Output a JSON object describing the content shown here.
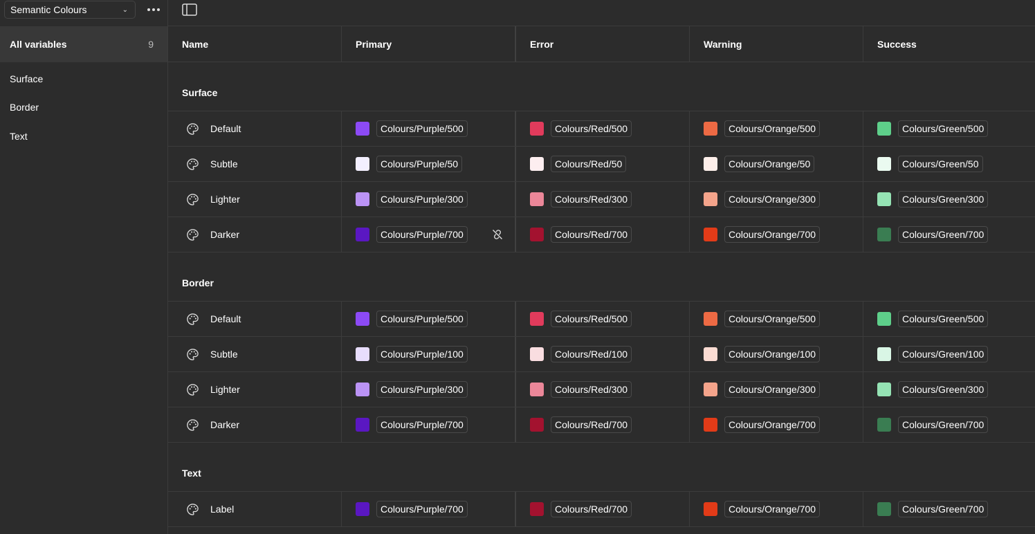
{
  "sidebar": {
    "collection": "Semantic Colours",
    "all_variables_label": "All variables",
    "all_variables_count": "9",
    "groups": [
      "Surface",
      "Border",
      "Text"
    ]
  },
  "columns": [
    "Name",
    "Primary",
    "Error",
    "Warning",
    "Success"
  ],
  "colors": {
    "Colours/Purple/500": "#8c4af5",
    "Colours/Purple/50": "#f3efff",
    "Colours/Purple/100": "#e8ddfd",
    "Colours/Purple/300": "#bb93f5",
    "Colours/Purple/700": "#5a17c2",
    "Colours/Red/500": "#e13b5c",
    "Colours/Red/50": "#fdeef0",
    "Colours/Red/100": "#f9dde0",
    "Colours/Red/300": "#eb8799",
    "Colours/Red/700": "#a3122f",
    "Colours/Orange/500": "#ed6a44",
    "Colours/Orange/50": "#fdefea",
    "Colours/Orange/100": "#fbdcd3",
    "Colours/Orange/300": "#f4a48b",
    "Colours/Orange/700": "#e23b18",
    "Colours/Green/500": "#5ecf8a",
    "Colours/Green/50": "#eafaf0",
    "Colours/Green/100": "#d9f6e5",
    "Colours/Green/300": "#95e3b4",
    "Colours/Green/700": "#3a7d52"
  },
  "groups": [
    {
      "title": "Surface",
      "rows": [
        {
          "name": "Default",
          "values": [
            "Colours/Purple/500",
            "Colours/Red/500",
            "Colours/Orange/500",
            "Colours/Green/500"
          ]
        },
        {
          "name": "Subtle",
          "values": [
            "Colours/Purple/50",
            "Colours/Red/50",
            "Colours/Orange/50",
            "Colours/Green/50"
          ]
        },
        {
          "name": "Lighter",
          "values": [
            "Colours/Purple/300",
            "Colours/Red/300",
            "Colours/Orange/300",
            "Colours/Green/300"
          ]
        },
        {
          "name": "Darker",
          "values": [
            "Colours/Purple/700",
            "Colours/Red/700",
            "Colours/Orange/700",
            "Colours/Green/700"
          ],
          "unlink": true
        }
      ]
    },
    {
      "title": "Border",
      "rows": [
        {
          "name": "Default",
          "values": [
            "Colours/Purple/500",
            "Colours/Red/500",
            "Colours/Orange/500",
            "Colours/Green/500"
          ]
        },
        {
          "name": "Subtle",
          "values": [
            "Colours/Purple/100",
            "Colours/Red/100",
            "Colours/Orange/100",
            "Colours/Green/100"
          ]
        },
        {
          "name": "Lighter",
          "values": [
            "Colours/Purple/300",
            "Colours/Red/300",
            "Colours/Orange/300",
            "Colours/Green/300"
          ]
        },
        {
          "name": "Darker",
          "values": [
            "Colours/Purple/700",
            "Colours/Red/700",
            "Colours/Orange/700",
            "Colours/Green/700"
          ]
        }
      ]
    },
    {
      "title": "Text",
      "rows": [
        {
          "name": "Label",
          "values": [
            "Colours/Purple/700",
            "Colours/Red/700",
            "Colours/Orange/700",
            "Colours/Green/700"
          ]
        }
      ]
    }
  ]
}
